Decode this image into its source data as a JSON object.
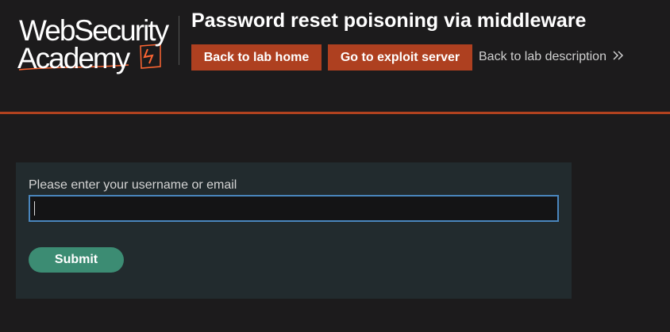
{
  "logo": {
    "line1": "WebSecurity",
    "line2": "Academy",
    "accent_color": "#ff6633"
  },
  "header": {
    "title": "Password reset poisoning via middleware",
    "buttons": {
      "lab_home": "Back to lab home",
      "exploit_server": "Go to exploit server"
    },
    "description_link": "Back to lab description",
    "description_link_icon": "double-chevron-right-icon",
    "rule_color": "#b1421f"
  },
  "form": {
    "label": "Please enter your username or email",
    "input_value": "",
    "submit_label": "Submit",
    "submit_color": "#3c8c73"
  }
}
